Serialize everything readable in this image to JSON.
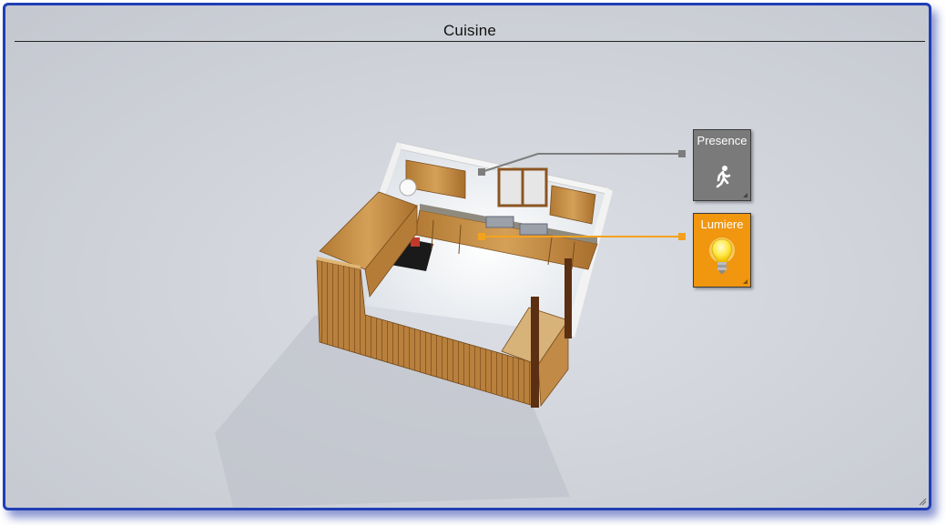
{
  "panel": {
    "title": "Cuisine"
  },
  "devices": [
    {
      "label": "Presence",
      "icon": "person-walking-icon",
      "color": "#7a7a7a",
      "line_color": "#7d7d7d"
    },
    {
      "label": "Lumiere",
      "icon": "light-bulb-icon",
      "color": "#f0960f",
      "line_color": "#f4a21e"
    }
  ],
  "colors": {
    "frame_border": "#1f3fb4",
    "wood": "#c98f3a",
    "floor": "#eef1f4"
  }
}
